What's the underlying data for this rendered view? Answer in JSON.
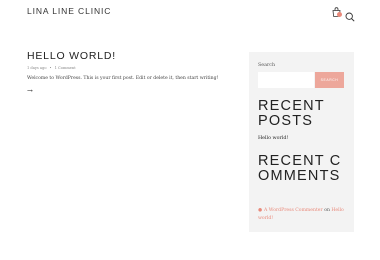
{
  "site": {
    "title": "LINA LINE CLINIC"
  },
  "header": {
    "cart_icon": "shopping-bag-icon",
    "search_icon": "search-icon",
    "accent_color": "#e9897a"
  },
  "post": {
    "title": "HELLO WORLD!",
    "date": "1 days ago",
    "separator": "•",
    "comments": "1 Comment",
    "excerpt": "Welcome to WordPress. This is your first post. Edit or delete it, then start writing!",
    "read_more_symbol": "→"
  },
  "sidebar": {
    "search_label": "Search",
    "search_value": "",
    "search_button": "SEARCH",
    "button_color": "#eda79b",
    "recent_posts_title": "RECENT POSTS",
    "recent_posts": [
      "Hello world!"
    ],
    "recent_comments_title": "RECENT COMMENTS",
    "comment": {
      "author": "A WordPress Commenter",
      "on": "on",
      "post": "Hello world!"
    }
  }
}
